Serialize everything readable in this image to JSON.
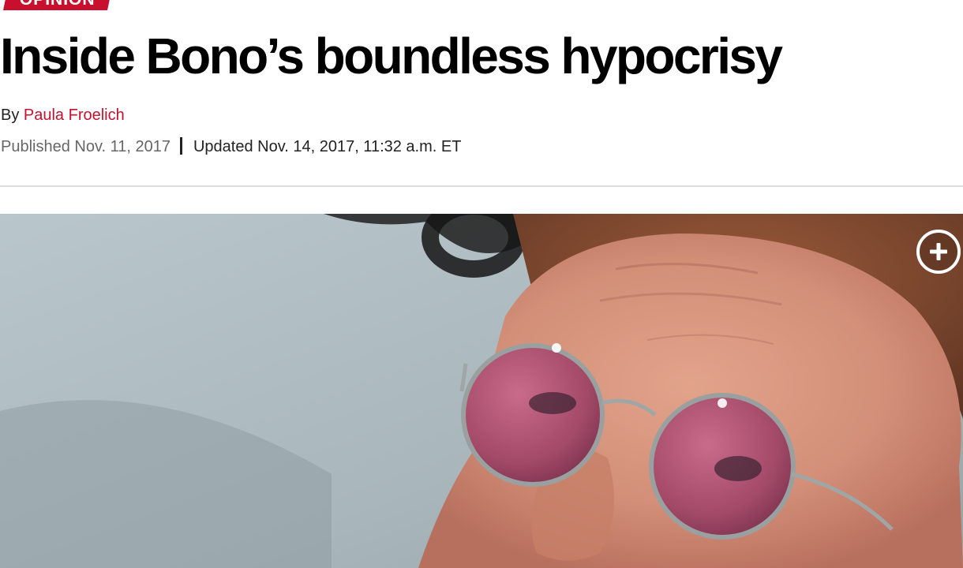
{
  "section": {
    "label": "OPINION"
  },
  "article": {
    "headline": "Inside Bono’s boundless hypocrisy",
    "byline_prefix": "By",
    "author": "Paula Froelich",
    "published": "Published Nov. 11, 2017",
    "updated": "Updated Nov. 14, 2017, 11:32 a.m. ET"
  },
  "photo": {
    "expand_icon": "plus-circle-icon"
  },
  "colors": {
    "brand_red": "#c8102e",
    "headline": "#000000",
    "meta_gray": "#666666"
  }
}
